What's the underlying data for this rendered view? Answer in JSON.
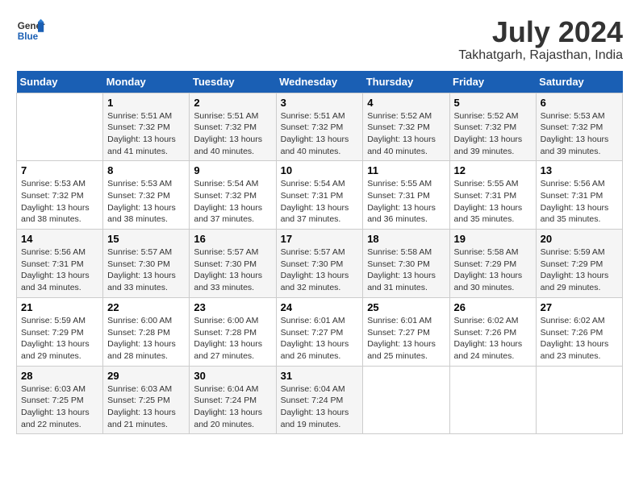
{
  "logo": {
    "line1": "General",
    "line2": "Blue"
  },
  "title": "July 2024",
  "location": "Takhatgarh, Rajasthan, India",
  "headers": [
    "Sunday",
    "Monday",
    "Tuesday",
    "Wednesday",
    "Thursday",
    "Friday",
    "Saturday"
  ],
  "weeks": [
    [
      {
        "day": "",
        "info": ""
      },
      {
        "day": "1",
        "info": "Sunrise: 5:51 AM\nSunset: 7:32 PM\nDaylight: 13 hours\nand 41 minutes."
      },
      {
        "day": "2",
        "info": "Sunrise: 5:51 AM\nSunset: 7:32 PM\nDaylight: 13 hours\nand 40 minutes."
      },
      {
        "day": "3",
        "info": "Sunrise: 5:51 AM\nSunset: 7:32 PM\nDaylight: 13 hours\nand 40 minutes."
      },
      {
        "day": "4",
        "info": "Sunrise: 5:52 AM\nSunset: 7:32 PM\nDaylight: 13 hours\nand 40 minutes."
      },
      {
        "day": "5",
        "info": "Sunrise: 5:52 AM\nSunset: 7:32 PM\nDaylight: 13 hours\nand 39 minutes."
      },
      {
        "day": "6",
        "info": "Sunrise: 5:53 AM\nSunset: 7:32 PM\nDaylight: 13 hours\nand 39 minutes."
      }
    ],
    [
      {
        "day": "7",
        "info": "Sunrise: 5:53 AM\nSunset: 7:32 PM\nDaylight: 13 hours\nand 38 minutes."
      },
      {
        "day": "8",
        "info": "Sunrise: 5:53 AM\nSunset: 7:32 PM\nDaylight: 13 hours\nand 38 minutes."
      },
      {
        "day": "9",
        "info": "Sunrise: 5:54 AM\nSunset: 7:32 PM\nDaylight: 13 hours\nand 37 minutes."
      },
      {
        "day": "10",
        "info": "Sunrise: 5:54 AM\nSunset: 7:31 PM\nDaylight: 13 hours\nand 37 minutes."
      },
      {
        "day": "11",
        "info": "Sunrise: 5:55 AM\nSunset: 7:31 PM\nDaylight: 13 hours\nand 36 minutes."
      },
      {
        "day": "12",
        "info": "Sunrise: 5:55 AM\nSunset: 7:31 PM\nDaylight: 13 hours\nand 35 minutes."
      },
      {
        "day": "13",
        "info": "Sunrise: 5:56 AM\nSunset: 7:31 PM\nDaylight: 13 hours\nand 35 minutes."
      }
    ],
    [
      {
        "day": "14",
        "info": "Sunrise: 5:56 AM\nSunset: 7:31 PM\nDaylight: 13 hours\nand 34 minutes."
      },
      {
        "day": "15",
        "info": "Sunrise: 5:57 AM\nSunset: 7:30 PM\nDaylight: 13 hours\nand 33 minutes."
      },
      {
        "day": "16",
        "info": "Sunrise: 5:57 AM\nSunset: 7:30 PM\nDaylight: 13 hours\nand 33 minutes."
      },
      {
        "day": "17",
        "info": "Sunrise: 5:57 AM\nSunset: 7:30 PM\nDaylight: 13 hours\nand 32 minutes."
      },
      {
        "day": "18",
        "info": "Sunrise: 5:58 AM\nSunset: 7:30 PM\nDaylight: 13 hours\nand 31 minutes."
      },
      {
        "day": "19",
        "info": "Sunrise: 5:58 AM\nSunset: 7:29 PM\nDaylight: 13 hours\nand 30 minutes."
      },
      {
        "day": "20",
        "info": "Sunrise: 5:59 AM\nSunset: 7:29 PM\nDaylight: 13 hours\nand 29 minutes."
      }
    ],
    [
      {
        "day": "21",
        "info": "Sunrise: 5:59 AM\nSunset: 7:29 PM\nDaylight: 13 hours\nand 29 minutes."
      },
      {
        "day": "22",
        "info": "Sunrise: 6:00 AM\nSunset: 7:28 PM\nDaylight: 13 hours\nand 28 minutes."
      },
      {
        "day": "23",
        "info": "Sunrise: 6:00 AM\nSunset: 7:28 PM\nDaylight: 13 hours\nand 27 minutes."
      },
      {
        "day": "24",
        "info": "Sunrise: 6:01 AM\nSunset: 7:27 PM\nDaylight: 13 hours\nand 26 minutes."
      },
      {
        "day": "25",
        "info": "Sunrise: 6:01 AM\nSunset: 7:27 PM\nDaylight: 13 hours\nand 25 minutes."
      },
      {
        "day": "26",
        "info": "Sunrise: 6:02 AM\nSunset: 7:26 PM\nDaylight: 13 hours\nand 24 minutes."
      },
      {
        "day": "27",
        "info": "Sunrise: 6:02 AM\nSunset: 7:26 PM\nDaylight: 13 hours\nand 23 minutes."
      }
    ],
    [
      {
        "day": "28",
        "info": "Sunrise: 6:03 AM\nSunset: 7:25 PM\nDaylight: 13 hours\nand 22 minutes."
      },
      {
        "day": "29",
        "info": "Sunrise: 6:03 AM\nSunset: 7:25 PM\nDaylight: 13 hours\nand 21 minutes."
      },
      {
        "day": "30",
        "info": "Sunrise: 6:04 AM\nSunset: 7:24 PM\nDaylight: 13 hours\nand 20 minutes."
      },
      {
        "day": "31",
        "info": "Sunrise: 6:04 AM\nSunset: 7:24 PM\nDaylight: 13 hours\nand 19 minutes."
      },
      {
        "day": "",
        "info": ""
      },
      {
        "day": "",
        "info": ""
      },
      {
        "day": "",
        "info": ""
      }
    ]
  ]
}
